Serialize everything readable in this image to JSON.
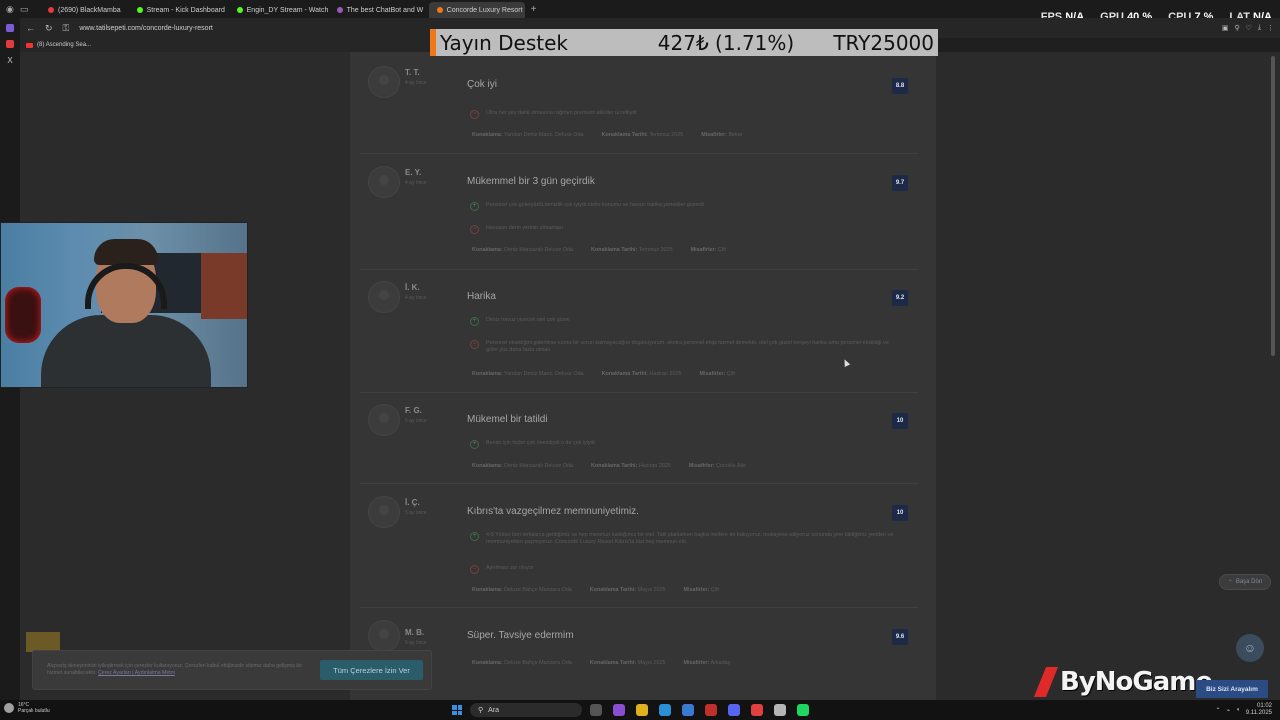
{
  "browser": {
    "tabs": [
      {
        "label": "(2690) BlackMamba",
        "color": "#e33b3b"
      },
      {
        "label": "Stream - Kick Dashboard",
        "color": "#53fc18"
      },
      {
        "label": "Engin_DY Stream - Watch",
        "color": "#53fc18"
      },
      {
        "label": "The best ChatBot and W",
        "color": "#9b59b6"
      },
      {
        "label": "Concorde Luxury Resort",
        "color": "#f07818"
      }
    ],
    "new_tab": "+",
    "url": "www.tatilsepeti.com/concorde-luxury-resort",
    "bookmark": "(8) Ascending Sea..."
  },
  "perf": {
    "fps_label": "FPS",
    "fps_value": "N/A",
    "gpu_label": "GPU",
    "gpu_value": "40 %",
    "cpu_label": "CPU",
    "cpu_value": "7 %",
    "lat_label": "LAT",
    "lat_value": "N/A"
  },
  "banner": {
    "title": "Yayın Destek",
    "amount": "427₺ (1.71%)",
    "goal": "TRY25000",
    "accent": "#f07818"
  },
  "reviews": [
    {
      "initials": "T. T.",
      "ago": "4 ay önce",
      "title": "Çok iyi",
      "score": "8.8",
      "lines": [
        {
          "type": "minus",
          "text": "Ultra her şey dahil olmasına rağmen premium alkoller ücretliydi"
        }
      ],
      "meta": [
        {
          "k": "Konaklama:",
          "v": "Yandan Deniz Manz. Deluxe Oda"
        },
        {
          "k": "Konaklama Tarihi:",
          "v": "Temmuz 2025"
        },
        {
          "k": "Misafirler:",
          "v": "Bekar"
        }
      ]
    },
    {
      "initials": "E. Y.",
      "ago": "4 ay önce",
      "title": "Mükemmel bir 3 gün geçirdik",
      "score": "9.7",
      "lines": [
        {
          "type": "plus",
          "text": "Personel çok güleryüzlü,temizlik çok iyiydi otelin konumu ve havası harika,yemekler güzeldi"
        },
        {
          "type": "minus",
          "text": "Havuzun derin yerinin olmaması"
        }
      ],
      "meta": [
        {
          "k": "Konaklama:",
          "v": "Deniz Manzaralı Deluxe Oda"
        },
        {
          "k": "Konaklama Tarihi:",
          "v": "Temmuz 2025"
        },
        {
          "k": "Misafirler:",
          "v": "Çift"
        }
      ]
    },
    {
      "initials": "İ. K.",
      "ago": "4 ay önce",
      "title": "Harika",
      "score": "9.2",
      "lines": [
        {
          "type": "plus",
          "text": "Deniz havuz yiyecek otel çok güzel"
        },
        {
          "type": "minus",
          "text": "Personel eksikliğini giderilirse sonra bir sorun kalmayacağını düşünüyorum, ekstra personel ekipi hizmet demektir, otel çok güzel herşeyi harika ama personel eksikliği ve güler yüz daha fazla olmalı"
        }
      ],
      "meta": [
        {
          "k": "Konaklama:",
          "v": "Yandan Deniz Manz. Deluxe Oda"
        },
        {
          "k": "Konaklama Tarihi:",
          "v": "Haziran 2025"
        },
        {
          "k": "Misafirler:",
          "v": "Çift"
        }
      ]
    },
    {
      "initials": "F. G.",
      "ago": "5 ay önce",
      "title": "Mükemel bir tatildi",
      "score": "10",
      "lines": [
        {
          "type": "plus",
          "text": "Benim için hiçbir çok önemliydi o da çok iyiydi"
        }
      ],
      "meta": [
        {
          "k": "Konaklama:",
          "v": "Deniz Manzaralı Deluxe Oda"
        },
        {
          "k": "Konaklama Tarihi:",
          "v": "Haziran 2025"
        },
        {
          "k": "Misafirler:",
          "v": "Çocuklu Aile"
        }
      ]
    },
    {
      "initials": "İ. Ç.",
      "ago": "5 ay önce",
      "title": "Kıbrıs'ta vazgeçilmez memnuniyetimiz.",
      "score": "10",
      "lines": [
        {
          "type": "plus",
          "text": "4-5 Yıldan beri defalarca geldiğimiz ve hep memnun kaldığımız bir otel. Tatil planlarken başka otellere de bakıyoruz, mukayese ediyoruz sonunda yine bildiğimiz yeriden ve memnuniyetten şaşmıyoruz. Concorde Luxury Resort Kıbrıs'ta bizi hep memnun etti."
        },
        {
          "type": "minus",
          "text": "Ayrılması zor oluyor"
        }
      ],
      "meta": [
        {
          "k": "Konaklama:",
          "v": "Deluxe Bahçe Manzara Oda"
        },
        {
          "k": "Konaklama Tarihi:",
          "v": "Mayıs 2025"
        },
        {
          "k": "Misafirler:",
          "v": "Çift"
        }
      ]
    },
    {
      "initials": "M. B.",
      "ago": "5 ay önce",
      "title": "Süper. Tavsiye edermim",
      "score": "9.6",
      "lines": [],
      "meta": [
        {
          "k": "Konaklama:",
          "v": "Deluxe Bahçe Manzara Oda"
        },
        {
          "k": "Konaklama Tarihi:",
          "v": "Mayıs 2025"
        },
        {
          "k": "Misafirler:",
          "v": "Arkadaş"
        }
      ]
    }
  ],
  "cookie": {
    "text": "Alışveriş deneyiminizi iyileştirmek için çerezler kullanıyoruz. Çerezleri kabul ettiğinizde sitemiz daha gelişmiş bir hizmet sunabilecektir.",
    "link": "Çerez Ayarları | Aydınlatma Metni",
    "accept": "Tüm Çerezlere İzin Ver"
  },
  "widgets": {
    "back_to_top": "Başa Dön",
    "call_us": "Biz Sizi Arayalım",
    "logo": "ByNoGame"
  },
  "taskbar": {
    "temp": "16°C",
    "weather": "Parçalı bulutlu",
    "search": "Ara",
    "time": "01:02",
    "date": "9.11.2025"
  }
}
